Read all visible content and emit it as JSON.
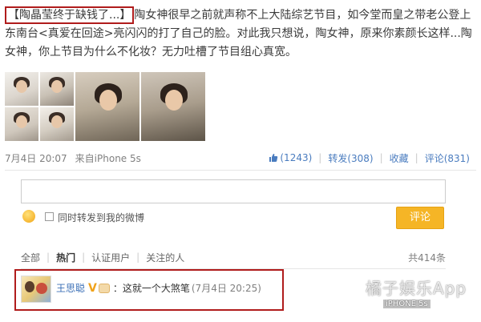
{
  "post": {
    "title_highlight": "【陶晶莹终于缺钱了...】",
    "body": "陶女神很早之前就声称不上大陆综艺节目，如今堂而皇之带老公登上东南台<真爱在回途>亮闪闪的打了自己的脸。对此我只想说，陶女神，原来你素颜长这样...陶女神，你上节目为什么不化妆？无力吐槽了节目组心真宽。"
  },
  "meta": {
    "time": "7月4日 20:07",
    "source": "来自iPhone 5s"
  },
  "actions": {
    "like": "(1243)",
    "repost": "转发(308)",
    "favorite": "收藏",
    "comment": "评论(831)"
  },
  "composer": {
    "repost_option": "同时转发到我的微博",
    "submit": "评论"
  },
  "filters": {
    "all": "全部",
    "hot": "热门",
    "verified": "认证用户",
    "following": "关注的人",
    "total": "共414条"
  },
  "comment": {
    "username": "王思聪",
    "vip_mark": "V",
    "text": "：这就一个大煞笔",
    "time": "(7月4日 20:25)"
  },
  "watermark": {
    "main": "橘子娱乐App",
    "sub": "iPHONE 5s"
  },
  "colors": {
    "link_blue": "#4a7cbf",
    "highlight_red": "#b01c1c",
    "submit_orange": "#f5b526"
  }
}
